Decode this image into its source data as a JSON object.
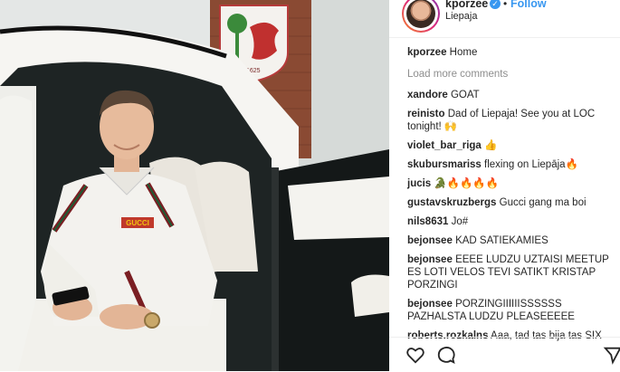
{
  "header": {
    "username": "kporzee",
    "verified_icon": "verified-badge-icon",
    "separator": "•",
    "follow_label": "Follow",
    "location": "Liepaja"
  },
  "caption": {
    "user": "kporzee",
    "text": "Home"
  },
  "load_more_label": "Load more comments",
  "comments": [
    {
      "user": "xandore",
      "text": "GOAT"
    },
    {
      "user": "reinisto",
      "text": "Dad of Liepaja! See you at LOC tonight! 🙌"
    },
    {
      "user": "violet_bar_riga",
      "text": "👍"
    },
    {
      "user": "skubursmariss",
      "text": "flexing on Liepāja🔥"
    },
    {
      "user": "jucis",
      "text": "🐊🔥🔥🔥🔥"
    },
    {
      "user": "gustavskruzbergs",
      "text": "Gucci gang ma boi"
    },
    {
      "user": "nils8631",
      "text": "Jo#"
    },
    {
      "user": "bejonsee",
      "text": "KAD SATIEKAMIES"
    },
    {
      "user": "bejonsee",
      "text": "EEEE LUDZU UZTAISI MEETUP ES LOTI VELOS TEVI SATIKT KRISTAP PORZINGI"
    },
    {
      "user": "bejonsee",
      "text": "PORZINGIIIIIISSSSSS PAZHALSTA LUDZU PLEASEEEEE"
    },
    {
      "user": "roberts.rozkalns",
      "text": "Aaa, tad tas bija tas SIX"
    }
  ],
  "photo": {
    "emblem_year": "1625",
    "jacket_logo": "GUCCI"
  },
  "actions": {
    "like_icon": "heart-icon",
    "comment_icon": "comment-bubble-icon",
    "share_icon": "share-icon"
  },
  "colors": {
    "link_blue": "#3897f0",
    "muted_gray": "#8e8e8e",
    "text": "#262626"
  }
}
